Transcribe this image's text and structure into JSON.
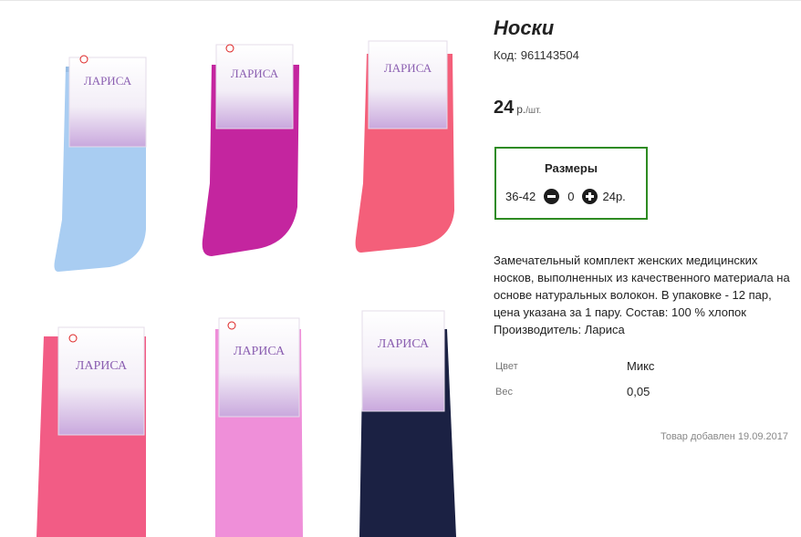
{
  "product": {
    "title": "Носки",
    "code_label": "Код:",
    "code_value": "961143504",
    "price_value": "24",
    "price_unit": "р.",
    "price_per": "/шт."
  },
  "sizes": {
    "title": "Размеры",
    "rows": [
      {
        "size": "36-42",
        "quantity": "0",
        "price": "24р."
      }
    ]
  },
  "description": "Замечательный комплект женских медицинских носков, выполненных из качественного материала на основе натуральных волокон. В упаковке - 12 пар, цена указана за 1 пару. Состав: 100 % хлопок Производитель: Лариса",
  "properties": [
    {
      "label": "Цвет",
      "value": "Микс"
    },
    {
      "label": "Вес",
      "value": "0,05"
    }
  ],
  "added_text": "Товар добавлен 19.09.2017",
  "photo": {
    "brand": "ЛАРИСА",
    "sock_colors": [
      "#a9cdf2",
      "#c4259f",
      "#f45f7a",
      "#f25c85",
      "#ef8fd9",
      "#1b2143"
    ],
    "accent_color": "#2e8b22"
  }
}
